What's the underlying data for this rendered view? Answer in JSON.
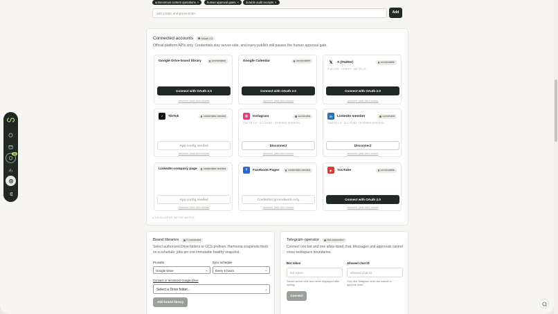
{
  "topics": {
    "chips": [
      "autonomous content operations",
      "human approval gates",
      "durable audit receipts"
    ],
    "placeholder": "add a topic and press Enter",
    "add_label": "Add"
  },
  "connected": {
    "title": "Connected accounts",
    "badge": "OAuth 2.0",
    "description": "Official platform APIs only. Credentials stay server-side, and every publish still passes the human approval gate.",
    "dev_notes": "▸ DEVELOPER SETUP NOTES",
    "accounts": [
      {
        "name": "Google Drive brand library",
        "status": "connectable",
        "meta": "",
        "button": "Connect with OAuth 2.0",
        "adv": "advanced: paste token instead"
      },
      {
        "name": "Google Calendar",
        "status": "connectable",
        "meta": "",
        "button": "Connect with OAuth 2.0",
        "adv": "advanced: paste token instead"
      },
      {
        "name": "X (Twitter)",
        "status": "connectable",
        "meta": "PUBLISH · VERIFY · METRICS",
        "button": "Connect with OAuth 2.0",
        "adv": "advanced: paste token instead"
      },
      {
        "name": "TikTok",
        "status": "credentials needed",
        "meta": "",
        "button": "App config needed",
        "adv": "advanced: paste token instead"
      },
      {
        "name": "Instagram",
        "status": "connected",
        "meta": "OAUTH 2.0 · ACCOUNT · EXPIRED SESSION",
        "button": "Disconnect",
        "adv": "advanced: paste token instead"
      },
      {
        "name": "LinkedIn member",
        "status": "connected",
        "meta": "OAUTH 2.0 · ACCOUNT · EXPIRED SESSION",
        "button": "Disconnect",
        "adv": "advanced: paste token instead"
      },
      {
        "name": "LinkedIn company page",
        "status": "credentials needed",
        "meta": "",
        "button": "App config needed",
        "adv": "advanced: paste token instead"
      },
      {
        "name": "Facebook Pages",
        "status": "credentials needed",
        "meta": "",
        "button": "Credential groundwork only",
        "adv": "advanced: paste token instead"
      },
      {
        "name": "YouTube",
        "status": "connectable",
        "meta": "",
        "button": "Connect with OAuth 2.0",
        "adv": "advanced: paste token instead"
      }
    ]
  },
  "brand": {
    "title": "Brand libraries",
    "badge": "0 connected",
    "description": "Select authorized Drive folders or GCS prefixes. Harmonia snapshots them on a schedule; jobs pin one immutable healthy snapshot.",
    "provider_label": "Provider",
    "provider_value": "Google Drive",
    "sync_label": "Sync schedule",
    "sync_value": "Every 6 hours",
    "connect_link": "Connect or reconnect Google Drive",
    "folder_value": "Select a Drive folder...",
    "add_label": "Add brand library"
  },
  "telegram": {
    "title": "Telegram operator",
    "badge": "Not connected",
    "description": "Connect one bot and one allow-listed chat. Messages and approvals cannot cross workspace boundaries.",
    "token_label": "Bot token",
    "token_placeholder": "bot token",
    "token_help": "Stored server-side and never displayed after saving.",
    "chat_label": "Allowed chat ID",
    "chat_placeholder": "allowed chat ID",
    "chat_help": "Only this Telegram chat can submit or approve work.",
    "connect_label": "Connect"
  },
  "rail": {
    "badge": "10"
  },
  "colors": {
    "dark": "#1e2a23",
    "page": "#f6f5f1",
    "accent": "#b9d86b"
  }
}
